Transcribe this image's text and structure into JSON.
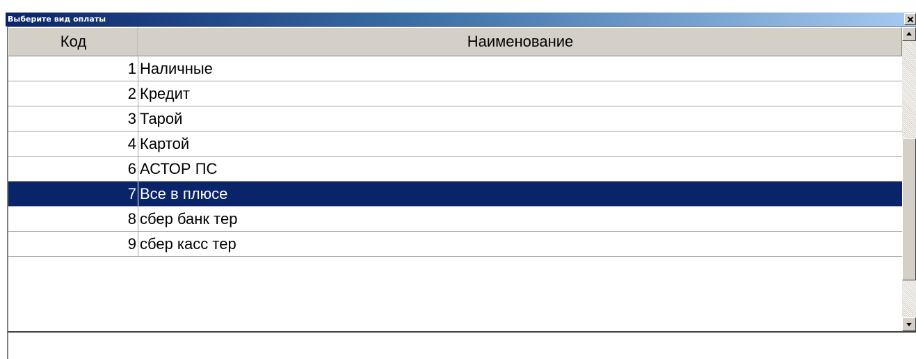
{
  "window": {
    "title": "Выберите вид оплаты"
  },
  "grid": {
    "columns": [
      {
        "label": "Код"
      },
      {
        "label": "Наименование"
      }
    ],
    "rows": [
      {
        "code": "1",
        "name": "Наличные",
        "selected": false
      },
      {
        "code": "2",
        "name": "Кредит",
        "selected": false
      },
      {
        "code": "3",
        "name": "Тарой",
        "selected": false
      },
      {
        "code": "4",
        "name": "Картой",
        "selected": false
      },
      {
        "code": "6",
        "name": "АСТОР ПС",
        "selected": false
      },
      {
        "code": "7",
        "name": "Все в плюсе",
        "selected": true
      },
      {
        "code": "8",
        "name": "сбер банк тер",
        "selected": false
      },
      {
        "code": "9",
        "name": "сбер касс тер",
        "selected": false
      }
    ]
  },
  "colors": {
    "selection": "#0a246a",
    "titlebar_start": "#0a246a",
    "titlebar_end": "#a6caf0",
    "face": "#d4d0c8"
  },
  "icons": {
    "close": "close-icon",
    "scroll_up": "scroll-up-arrow-icon",
    "scroll_down": "scroll-down-arrow-icon"
  }
}
